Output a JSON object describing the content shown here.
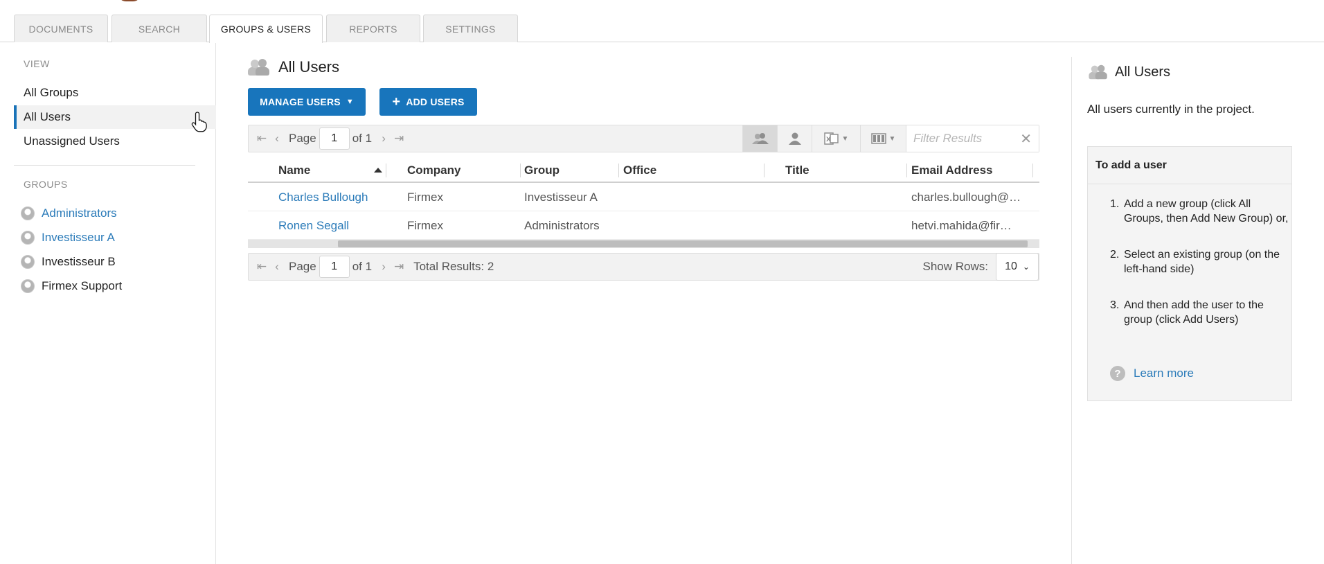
{
  "tabs": [
    {
      "label": "DOCUMENTS"
    },
    {
      "label": "SEARCH"
    },
    {
      "label": "GROUPS & USERS"
    },
    {
      "label": "REPORTS"
    },
    {
      "label": "SETTINGS"
    }
  ],
  "sidebar": {
    "view_heading": "VIEW",
    "view_items": [
      {
        "label": "All Groups"
      },
      {
        "label": "All Users"
      },
      {
        "label": "Unassigned Users"
      }
    ],
    "groups_heading": "GROUPS",
    "groups": [
      {
        "label": "Administrators"
      },
      {
        "label": "Investisseur A"
      },
      {
        "label": "Investisseur B"
      },
      {
        "label": "Firmex Support"
      }
    ]
  },
  "main": {
    "title": "All Users",
    "manage_users_label": "MANAGE USERS",
    "add_users_label": "ADD USERS",
    "pager": {
      "page_label": "Page",
      "page_value": "1",
      "of_label": "of 1",
      "total_results": "Total Results: 2",
      "show_rows_label": "Show Rows:",
      "show_rows_value": "10"
    },
    "filter_placeholder": "Filter Results",
    "columns": [
      "Name",
      "Company",
      "Group",
      "Office",
      "Title",
      "Email Address"
    ],
    "rows": [
      {
        "name": "Charles Bullough",
        "company": "Firmex",
        "group": "Investisseur A",
        "office": "",
        "title": "",
        "email": "charles.bullough@…"
      },
      {
        "name": "Ronen Segall",
        "company": "Firmex",
        "group": "Administrators",
        "office": "",
        "title": "",
        "email": "hetvi.mahida@fir…"
      }
    ]
  },
  "panel": {
    "title": "All Users",
    "description": "All users currently in the project.",
    "help_heading": "To add a user",
    "steps": [
      {
        "num": "1.",
        "text": "Add a new group (click All Groups, then Add New Group) or,"
      },
      {
        "num": "2.",
        "text": "Select an existing group (on the left-hand side)"
      },
      {
        "num": "3.",
        "text": "And then add the user to the group (click Add Users)"
      }
    ],
    "learn_more": "Learn more"
  },
  "colors": {
    "accent": "#1875bc",
    "link": "#2b7bb9"
  }
}
